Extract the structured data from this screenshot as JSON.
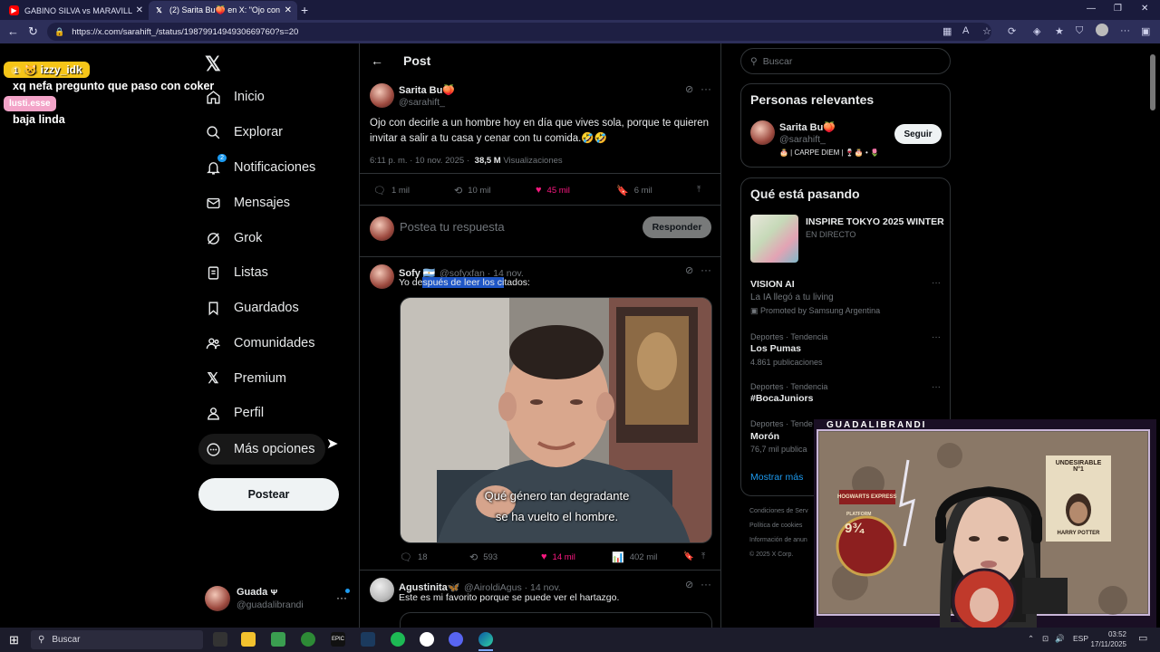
{
  "browser": {
    "tabs": [
      {
        "title": "GABINO SILVA vs MARAVILLA - S",
        "icon": "youtube-icon"
      },
      {
        "title": "(2) Sarita Bu🍑 en X: \"Ojo con de",
        "icon": "x-icon"
      }
    ],
    "url": "https://x.com/sarahift_/status/1987991494930669760?s=20"
  },
  "overlay_chat": {
    "badge_count": "1",
    "user1": "izzy_idk",
    "msg1": "xq nefa pregunto que paso con coker",
    "user2": "lusti.esse",
    "msg2": "baja linda"
  },
  "sidebar": {
    "logo": "X",
    "items": [
      {
        "label": "Inicio",
        "icon": "home-icon"
      },
      {
        "label": "Explorar",
        "icon": "search-icon"
      },
      {
        "label": "Notificaciones",
        "icon": "bell-icon",
        "badge": "2"
      },
      {
        "label": "Mensajes",
        "icon": "mail-icon"
      },
      {
        "label": "Grok",
        "icon": "grok-icon"
      },
      {
        "label": "Listas",
        "icon": "list-icon"
      },
      {
        "label": "Guardados",
        "icon": "bookmark-icon"
      },
      {
        "label": "Comunidades",
        "icon": "people-icon"
      },
      {
        "label": "Premium",
        "icon": "x-icon"
      },
      {
        "label": "Perfil",
        "icon": "person-icon"
      },
      {
        "label": "Más opciones",
        "icon": "more-circle-icon"
      }
    ],
    "post_button": "Postear",
    "account": {
      "name": "Guada ᴪ",
      "handle": "@guadalibrandi"
    }
  },
  "main": {
    "header": "Post",
    "post": {
      "name": "Sarita Bu🍑",
      "handle": "@sarahift_",
      "text": "Ojo con decirle a un hombre hoy en día que vives sola, porque te quieren invitar a salir a tu casa y cenar con tu comida.🤣🤣",
      "time": "6:11 p. m. · 10 nov. 2025 ·",
      "views": "38,5 M",
      "views_label": "Visualizaciones",
      "replies": "1 mil",
      "reposts": "10 mil",
      "likes": "45 mil",
      "bookmarks": "6 mil"
    },
    "reply_box": {
      "placeholder": "Postea tu respuesta",
      "button": "Responder"
    },
    "reply1": {
      "name": "Sofy 🇦🇷",
      "handle": "@sofyxfan · 14 nov.",
      "text_pre": "Yo de",
      "text_sel": "spués de leer los ci",
      "text_post": "tados:",
      "subtitle1": "Qué género tan degradante",
      "subtitle2": "se ha vuelto el hombre.",
      "replies": "18",
      "reposts": "593",
      "likes": "14 mil",
      "views": "402 mil"
    },
    "reply2": {
      "name": "Agustinita🦋",
      "handle": "@AiroldiAgus · 14 nov.",
      "text": "Este es mi favorito porque se puede ver el hartazgo."
    }
  },
  "right": {
    "search_placeholder": "Buscar",
    "relevant": {
      "title": "Personas relevantes",
      "name": "Sarita Bu🍑",
      "handle": "@sarahift_",
      "bio": "🎂 | CARPE DIEM | 🍷🎂 • 🌷",
      "follow": "Seguir"
    },
    "trends": {
      "title": "Qué está pasando",
      "items": [
        {
          "title": "INSPIRE TOKYO 2025 WINTER",
          "meta": "EN DIRECTO"
        },
        {
          "title": "VISION AI",
          "meta": "La IA llegó a tu living",
          "promo": "Promoted by Samsung Argentina"
        },
        {
          "meta": "Deportes · Tendencia",
          "title": "Los Pumas",
          "count": "4.861 publicaciones"
        },
        {
          "meta": "Deportes · Tendencia",
          "title": "#BocaJuniors"
        },
        {
          "meta": "Deportes · Tende",
          "title": "Morón",
          "count": "76,7 mil publica"
        }
      ],
      "show_more": "Mostrar más"
    },
    "footer": [
      "Condiciones de Serv",
      "Política de cookies",
      "Información de anun",
      "© 2025 X Corp."
    ]
  },
  "webcam": {
    "label": "GUADALIBRANDI",
    "poster1": "UNDESIRABLE N°1",
    "poster2": "HARRY POTTER",
    "sign": "9¾",
    "sign_text": "HOGWARTS EXPRESS",
    "sign_bottom": "PLATFORM"
  },
  "taskbar": {
    "search": "Buscar",
    "lang": "ESP",
    "time": "03:52",
    "date": "17/11/2025"
  }
}
